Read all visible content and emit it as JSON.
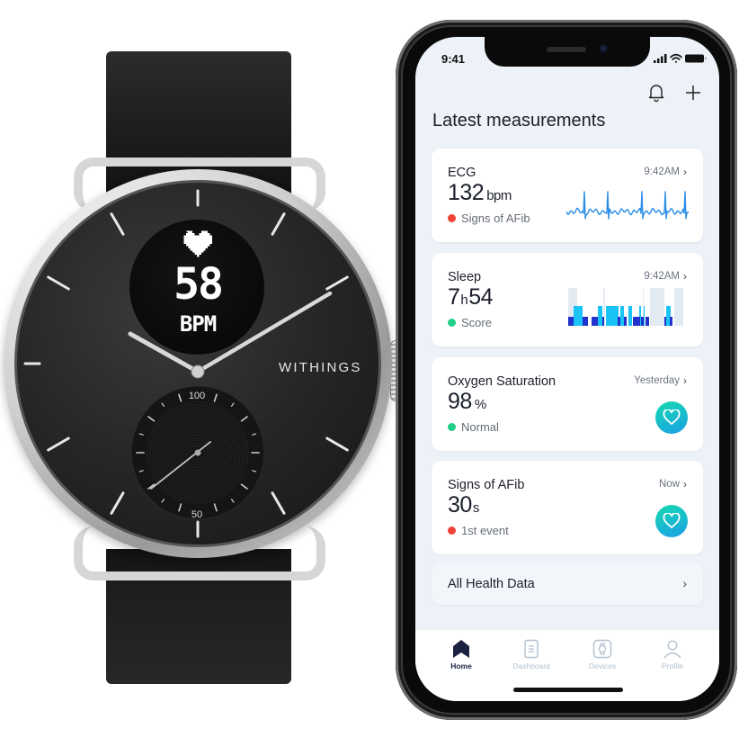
{
  "watch": {
    "brand": "WITHINGS",
    "display": {
      "icon": "heart-icon",
      "value": "58",
      "unit": "BPM"
    },
    "subdial": {
      "top_label": "100",
      "bottom_label": "50"
    }
  },
  "phone": {
    "status_bar": {
      "time": "9:41",
      "icons": [
        "signal-icon",
        "wifi-icon",
        "battery-icon"
      ]
    },
    "header": {
      "icons": [
        "bell-icon",
        "plus-icon"
      ]
    },
    "title": "Latest measurements",
    "cards": [
      {
        "title": "ECG",
        "value": "132",
        "unit": "bpm",
        "status": "Signs of AFib",
        "status_color": "#ef4437",
        "time": "9:42AM",
        "visual": "ecg-waveform"
      },
      {
        "title": "Sleep",
        "value_hours": "7",
        "hours_unit": "h",
        "value_minutes": "54",
        "status": "Score",
        "status_color": "#21cf86",
        "time": "9:42AM",
        "visual": "sleep-hypnogram"
      },
      {
        "title": "Oxygen Saturation",
        "value": "98",
        "unit": "%",
        "status": "Normal",
        "status_color": "#21cf86",
        "time": "Yesterday",
        "visual": "heart-badge"
      },
      {
        "title": "Signs of AFib",
        "value": "30",
        "unit": "s",
        "status": "1st event",
        "status_color": "#ef4437",
        "time": "Now",
        "visual": "heart-badge"
      }
    ],
    "all_health": {
      "label": "All Health Data"
    },
    "tabs": [
      {
        "label": "Home",
        "icon": "home-icon",
        "active": true
      },
      {
        "label": "Dashboard",
        "icon": "dashboard-icon",
        "active": false
      },
      {
        "label": "Devices",
        "icon": "watch-icon",
        "active": false
      },
      {
        "label": "Profile",
        "icon": "profile-icon",
        "active": false
      }
    ],
    "colors": {
      "accent_dark": "#1b2240",
      "tab_inactive": "#b3c1cf",
      "badge_from": "#17d9b0",
      "badge_to": "#1aa0e6",
      "ecg_line": "#2b8de6",
      "sleep_light": "#19c3f5",
      "sleep_deep": "#2233cc",
      "sleep_awake": "#e3ebf2"
    }
  }
}
